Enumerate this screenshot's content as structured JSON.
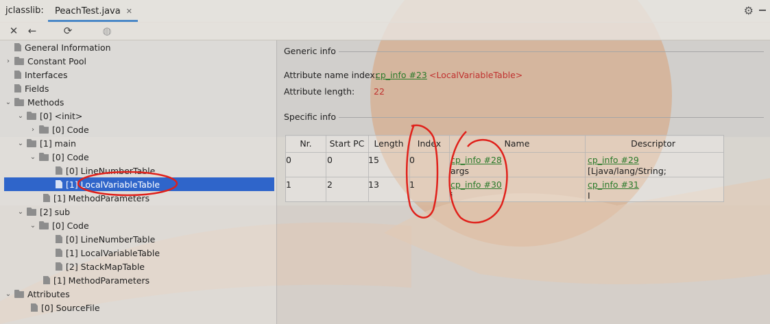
{
  "app": {
    "title": "jclasslib:"
  },
  "tab": {
    "label": "PeachTest.java"
  },
  "tree": {
    "items": [
      {
        "label": "General Information"
      },
      {
        "label": "Constant Pool"
      },
      {
        "label": "Interfaces"
      },
      {
        "label": "Fields"
      },
      {
        "label": "Methods"
      },
      {
        "label": "[0] <init>"
      },
      {
        "label": "[0] Code"
      },
      {
        "label": "[1] main"
      },
      {
        "label": "[0] Code"
      },
      {
        "label": "[0] LineNumberTable"
      },
      {
        "label": "[1] LocalVariableTable"
      },
      {
        "label": "[1] MethodParameters"
      },
      {
        "label": "[2] sub"
      },
      {
        "label": "[0] Code"
      },
      {
        "label": "[0] LineNumberTable"
      },
      {
        "label": "[1] LocalVariableTable"
      },
      {
        "label": "[2] StackMapTable"
      },
      {
        "label": "[1] MethodParameters"
      },
      {
        "label": "Attributes"
      },
      {
        "label": "[0] SourceFile"
      }
    ]
  },
  "generic": {
    "title": "Generic info",
    "name_index_label": "Attribute name index:",
    "name_index_link": "cp_info #23",
    "name_index_value": "<LocalVariableTable>",
    "length_label": "Attribute length:",
    "length_value": "22"
  },
  "specific": {
    "title": "Specific info",
    "columns": [
      "Nr.",
      "Start PC",
      "Length",
      "Index",
      "Name",
      "Descriptor"
    ],
    "rows": [
      {
        "nr": "0",
        "start_pc": "0",
        "length": "15",
        "index": "0",
        "name_link": "cp_info #28",
        "name_value": "args",
        "desc_link": "cp_info #29",
        "desc_value": "[Ljava/lang/String;"
      },
      {
        "nr": "1",
        "start_pc": "2",
        "length": "13",
        "index": "1",
        "name_link": "cp_info #30",
        "name_value": "i",
        "desc_link": "cp_info #31",
        "desc_value": "I"
      }
    ]
  },
  "colors": {
    "selection": "#2f65ca",
    "link": "#2a7a2a",
    "red_value": "#c0302e",
    "annotation": "#e0201a"
  }
}
